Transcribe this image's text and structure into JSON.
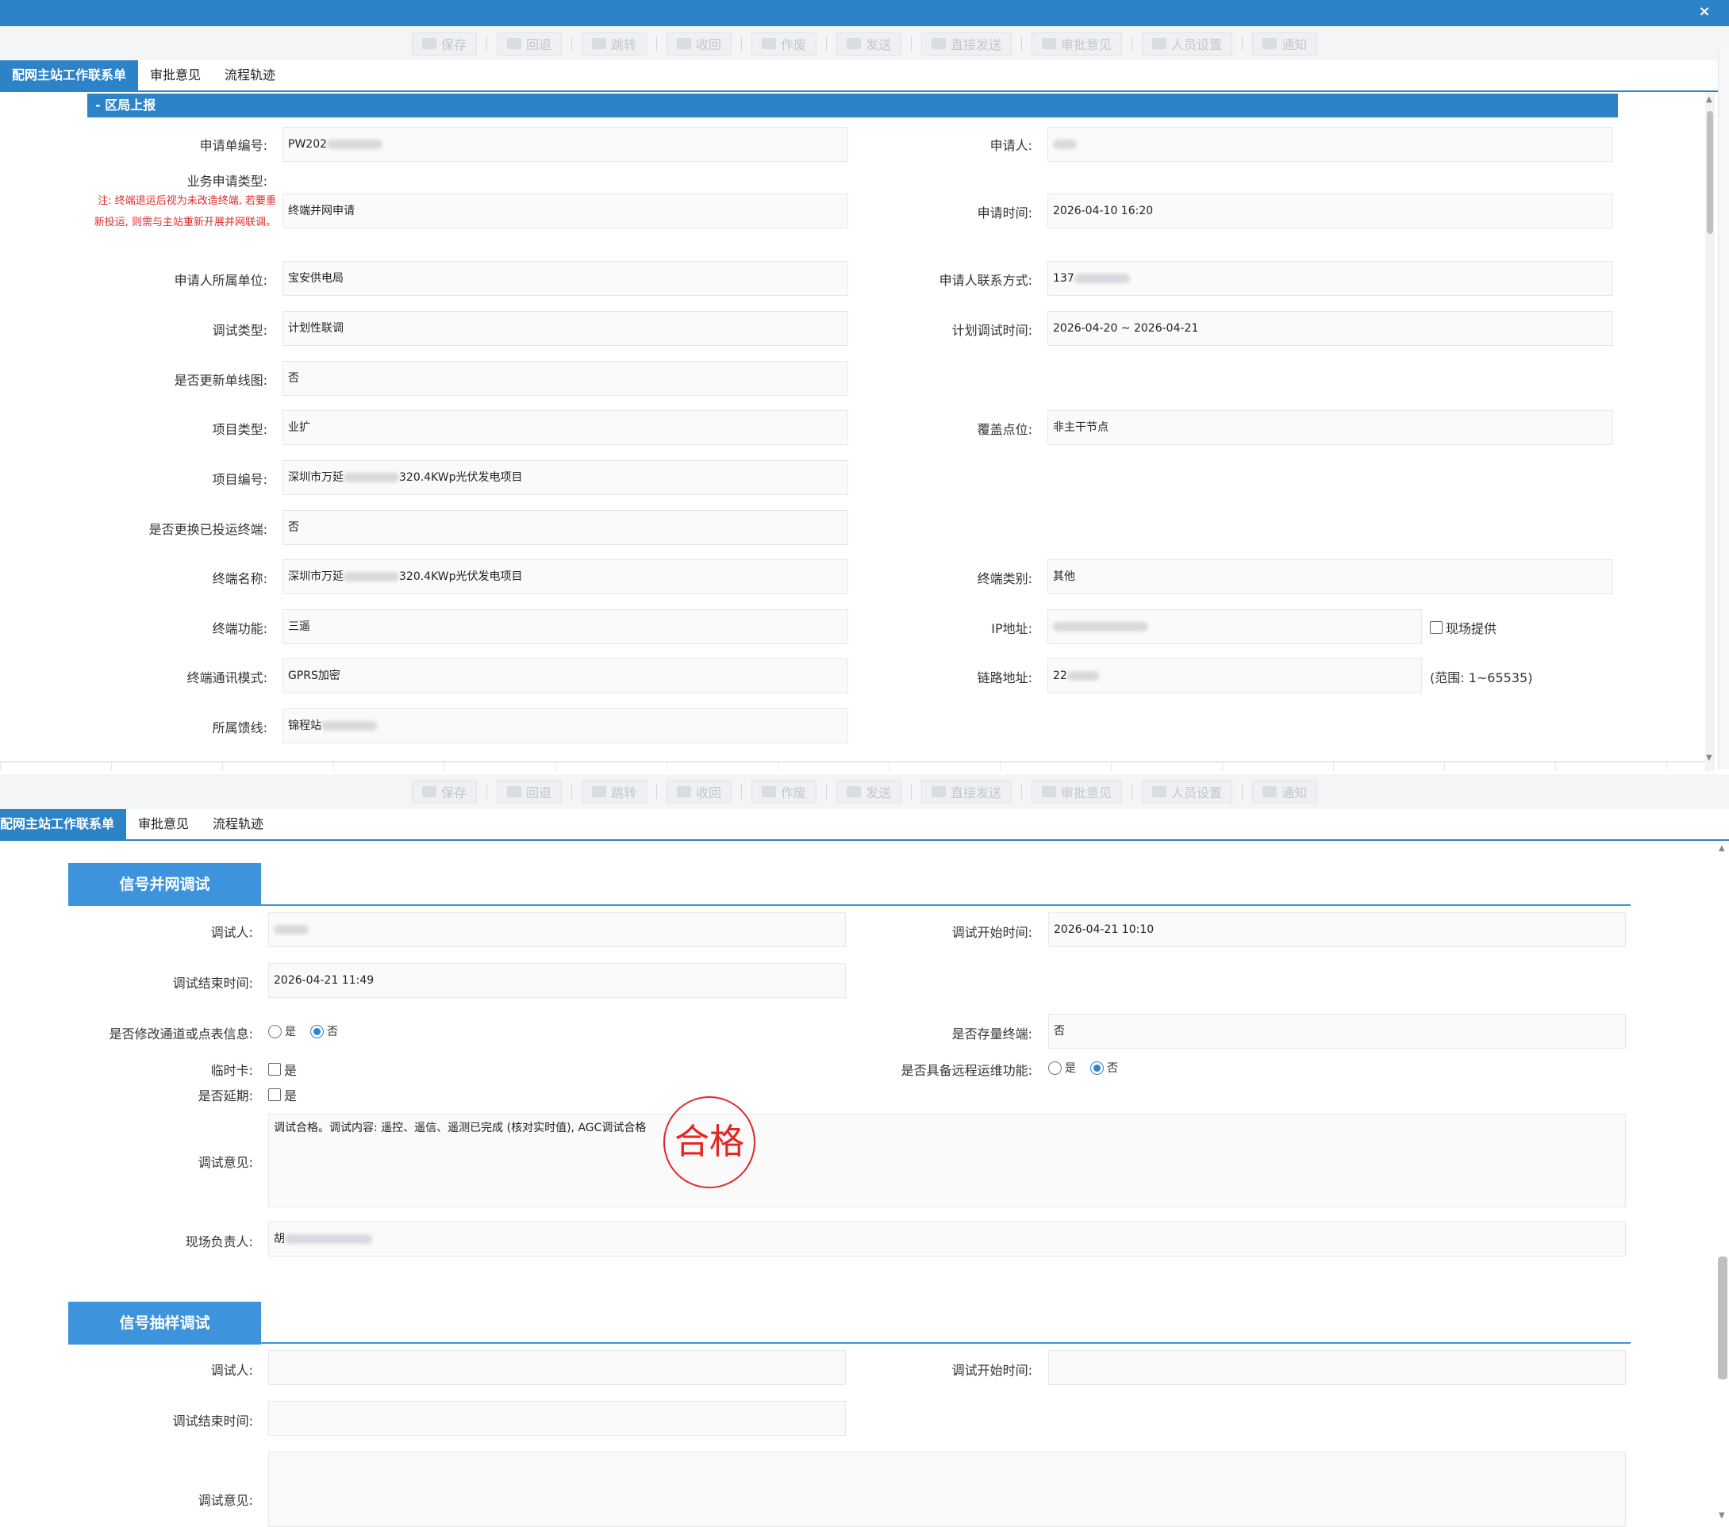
{
  "window": {
    "close": "×"
  },
  "toolbar": [
    "保存",
    "回退",
    "跳转",
    "收回",
    "作废",
    "发送",
    "直接发送",
    "审批意见",
    "人员设置",
    "通知"
  ],
  "tabs": [
    "配网主站工作联系单",
    "审批意见",
    "流程轨迹"
  ],
  "top_section": {
    "title": "- 区局上报",
    "labels": {
      "app_no": "申请单编号:",
      "applicant": "申请人:",
      "biz_type": "业务申请类型:",
      "note": "注: 终端退运后视为未改造终端, 若要重新投运, 则需与主站重新开展并网联调。",
      "apply_time": "申请时间:",
      "unit": "申请人所属单位:",
      "contact": "申请人联系方式:",
      "debug_type": "调试类型:",
      "plan_time": "计划调试时间:",
      "update_diagram": "是否更新单线图:",
      "project_type": "项目类型:",
      "coverage": "覆盖点位:",
      "project_no": "项目编号:",
      "replace_terminal": "是否更换已投运终端:",
      "terminal_name": "终端名称:",
      "terminal_class": "终端类别:",
      "terminal_func": "终端功能:",
      "ip": "IP地址:",
      "comm_mode": "终端通讯模式:",
      "link_addr": "链路地址:",
      "feeder": "所属馈线:"
    },
    "values": {
      "app_no": "PW202",
      "biz_type": "终端并网申请",
      "apply_time": "2026-04-10 16:20",
      "unit": "宝安供电局",
      "contact": "137",
      "debug_type": "计划性联调",
      "plan_time": "2026-04-20 ~ 2026-04-21",
      "update_diagram": "否",
      "project_type": "业扩",
      "coverage": "非主干节点",
      "project_no_a": "深圳市万延",
      "project_no_b": "320.4KWp光伏发电项目",
      "replace_terminal": "否",
      "terminal_name_a": "深圳市万延",
      "terminal_name_b": "320.4KWp光伏发电项目",
      "terminal_class": "其他",
      "terminal_func": "三遥",
      "comm_mode": "GPRS加密",
      "link_addr": "22",
      "feeder": "锦程站"
    },
    "onsite_label": "现场提供",
    "range_text": "(范围: 1~65535)"
  },
  "bottom": {
    "section1": {
      "title": "信号并网调试",
      "labels": {
        "tester": "调试人:",
        "start": "调试开始时间:",
        "end": "调试结束时间:",
        "modify_channel": "是否修改通道或点表信息:",
        "stock_terminal": "是否存量终端:",
        "temp_card": "临时卡:",
        "remote_ops": "是否具备远程运维功能:",
        "delay": "是否延期:",
        "opinion": "调试意见:",
        "onsite_lead": "现场负责人:"
      },
      "values": {
        "start": "2026-04-21 10:10",
        "end": "2026-04-21 11:49",
        "stock_terminal": "否",
        "opinion": "调试合格。调试内容: 遥控、遥信、遥测已完成 (核对实时值), AGC调试合格",
        "onsite_lead": "胡"
      },
      "yes": "是",
      "no": "否"
    },
    "section2": {
      "title": "信号抽样调试",
      "labels": {
        "tester": "调试人:",
        "start": "调试开始时间:",
        "end": "调试结束时间:",
        "opinion": "调试意见:"
      }
    },
    "stamp": "合格"
  }
}
